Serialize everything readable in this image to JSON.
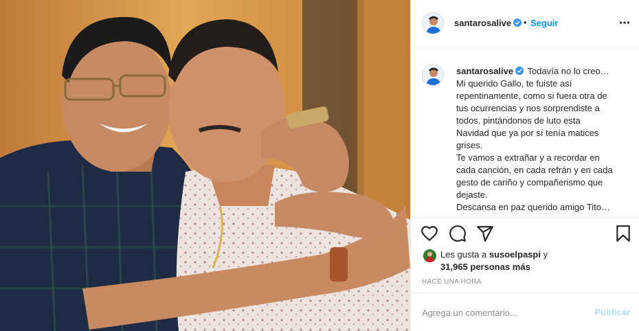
{
  "account": {
    "username": "santarosalive",
    "verified": true,
    "dot": "•",
    "follow_label": "Seguir"
  },
  "post": {
    "image_alt": "",
    "caption_lines": [
      "Todavía no lo creo…",
      "Mi querido Gallo, te fuiste así",
      "repentinamente, como si fuera otra de",
      "tus ocurrencias y nos sorprendiste a",
      "todos, pintándonos de luto esta",
      "Navidad que ya por sí tenía matices",
      "grises.",
      "Te vamos a extrañar y a recordar en",
      "cada canción, en cada refrán y en cada",
      "gesto de cariño y compañerismo que",
      "dejaste.",
      "Descansa en paz querido amigo Tito…"
    ]
  },
  "likes": {
    "prefix": "Les gusta a ",
    "first_user": "susoelpaspi",
    "connector": " y",
    "others": "31,965 personas más"
  },
  "timestamp": "Hace una hora",
  "comment": {
    "placeholder": "Agrega un comentario...",
    "publish_label": "Publicar"
  },
  "icons": {
    "like": "heart-icon",
    "comment": "comment-bubble-icon",
    "share": "paper-plane-icon",
    "save": "bookmark-icon",
    "more": "more-options-icon",
    "verified": "verified-badge-icon"
  },
  "colors": {
    "link_blue": "#0095f6",
    "publish_disabled": "#b2dffc",
    "verified_blue": "#3897f0",
    "muted": "#8e8e8e",
    "border": "#efefef"
  }
}
